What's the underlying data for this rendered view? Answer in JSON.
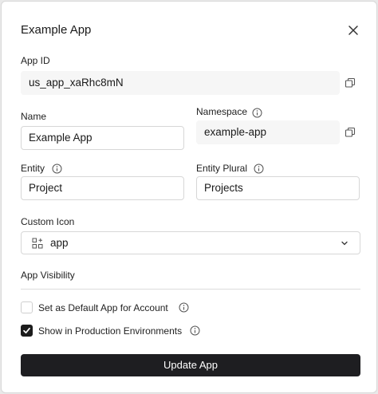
{
  "dialog": {
    "title": "Example App"
  },
  "fields": {
    "app_id": {
      "label": "App ID",
      "value": "us_app_xaRhc8mN"
    },
    "name": {
      "label": "Name",
      "value": "Example App"
    },
    "namespace": {
      "label": "Namespace",
      "value": "example-app"
    },
    "entity": {
      "label": "Entity",
      "value": "Project"
    },
    "entity_plural": {
      "label": "Entity Plural",
      "value": "Projects"
    },
    "custom_icon": {
      "label": "Custom Icon",
      "value": "app"
    }
  },
  "visibility": {
    "heading": "App Visibility",
    "default_app": {
      "label": "Set as Default App for Account",
      "checked": false
    },
    "production": {
      "label": "Show in Production Environments",
      "checked": true
    }
  },
  "actions": {
    "update_label": "Update App"
  },
  "colors": {
    "primary_button": "#1e1e21",
    "readonly_bg": "#f6f6f6"
  },
  "icons": [
    "close-icon",
    "copy-icon",
    "info-icon",
    "grid-plus-icon",
    "chevron-down-icon",
    "checkmark-icon"
  ]
}
